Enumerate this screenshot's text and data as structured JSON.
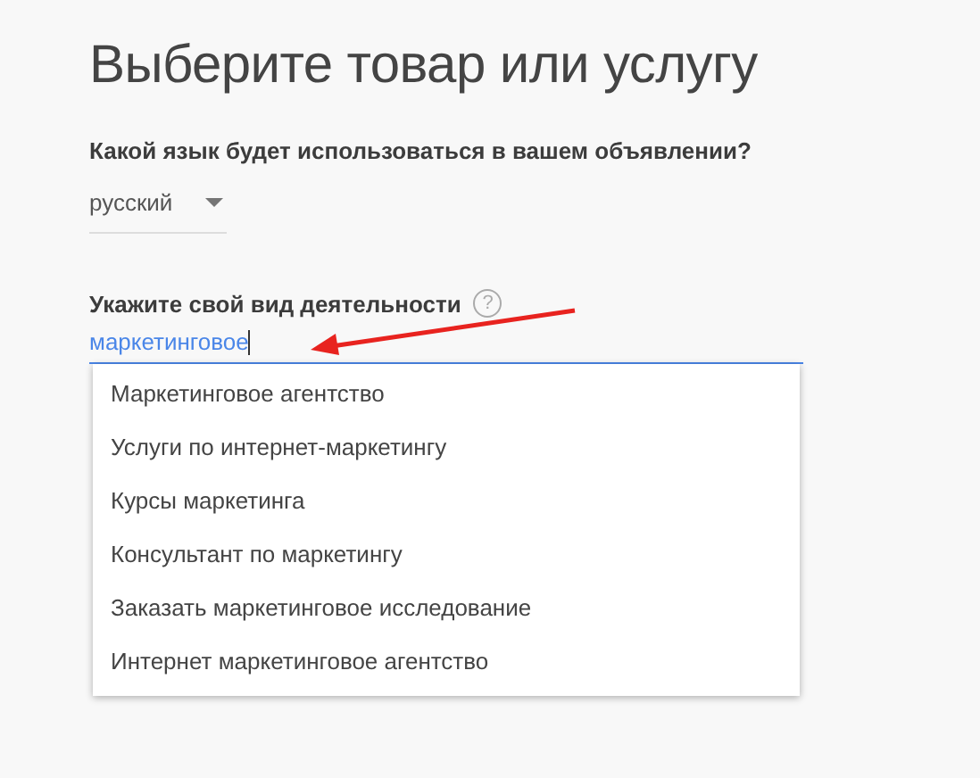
{
  "title": "Выберите товар или услугу",
  "language": {
    "label": "Какой язык будет использоваться в вашем объявлении?",
    "value": "русский"
  },
  "activity": {
    "label": "Укажите свой вид деятельности",
    "help": "?",
    "value": "маркетинговое",
    "focused": true
  },
  "suggestions": [
    {
      "label": "Маркетинговое агентство"
    },
    {
      "label": "Услуги по интернет-маркетингу"
    },
    {
      "label": "Курсы маркетинга"
    },
    {
      "label": "Консультант по маркетингу"
    },
    {
      "label": "Заказать маркетинговое исследование"
    },
    {
      "label": "Интернет маркетинговое агентство"
    }
  ]
}
